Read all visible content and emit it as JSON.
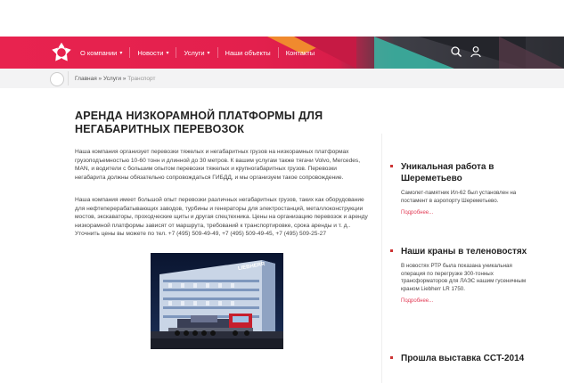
{
  "header": {
    "nav": [
      {
        "label": "О компании",
        "caret": "▾"
      },
      {
        "label": "Новости",
        "caret": "▾"
      },
      {
        "label": "Услуги",
        "caret": "▾"
      },
      {
        "label": "Наши объекты",
        "caret": ""
      },
      {
        "label": "Контакты",
        "caret": ""
      }
    ]
  },
  "breadcrumb": {
    "home": "Главная",
    "sep1": " » ",
    "services": "Услуги",
    "sep2": " » ",
    "current": "Транспорт"
  },
  "main": {
    "title": "АРЕНДА НИЗКОРАМНОЙ ПЛАТФОРМЫ ДЛЯ НЕГАБАРИТНЫХ ПЕРЕВОЗОК",
    "paragraph1": "Наша компания организует перевозки тяжелых и негабаритных грузов на низкорамных платформах грузоподъемностью 10-60 тонн и длинной до 30 метров. К вашим услугам также тягачи Volvo, Mercedes, MAN, и водители с большим опытом перевозки тяжелых и крупногабаритных грузов. Перевозки негабарита должны обязательно сопровождаться ГИБДД, и мы организуем такое сопровождение.",
    "paragraph2": "Наша компания имеет большой опыт перевозки различных негабаритных грузов, таких как оборудование для нефтеперерабатывающих заводов, турбины и генераторы для электростанций, металлоконструкции мостов, экскаваторы, проходческие щиты и другая спецтехника. Цены на организацию перевозок и аренду низкорамной платформы зависят от маршрута, требований к транспортировке, срока аренды и т. д.. Уточнить цены вы можете по тел. +7 (495) 509-49-49, +7 (495) 509-49-45, +7 (495) 509-25-27",
    "photo_sign": "LIEBHERR"
  },
  "sidebar": {
    "news": [
      {
        "title": "Уникальная работа в Шереметьево",
        "text": "Самолет-памятник Ил-62 был установлен на постамент в аэропорту Шереметьево.",
        "more": "Подробнее..."
      },
      {
        "title": "Наши краны в теленовостях",
        "text": "В новостях РТР была показана уникальная операция по перегрузке 300-тонных трансформаторов для ЛАЭС нашим гусеничным краном Liebherr LR 1750.",
        "more": "Подробнее..."
      },
      {
        "title": "Прошла выставка CCT-2014",
        "text": "",
        "more": ""
      }
    ]
  },
  "colors": {
    "brand_red": "#e8234f",
    "dark": "#2c2d33",
    "link": "#e23c56"
  }
}
